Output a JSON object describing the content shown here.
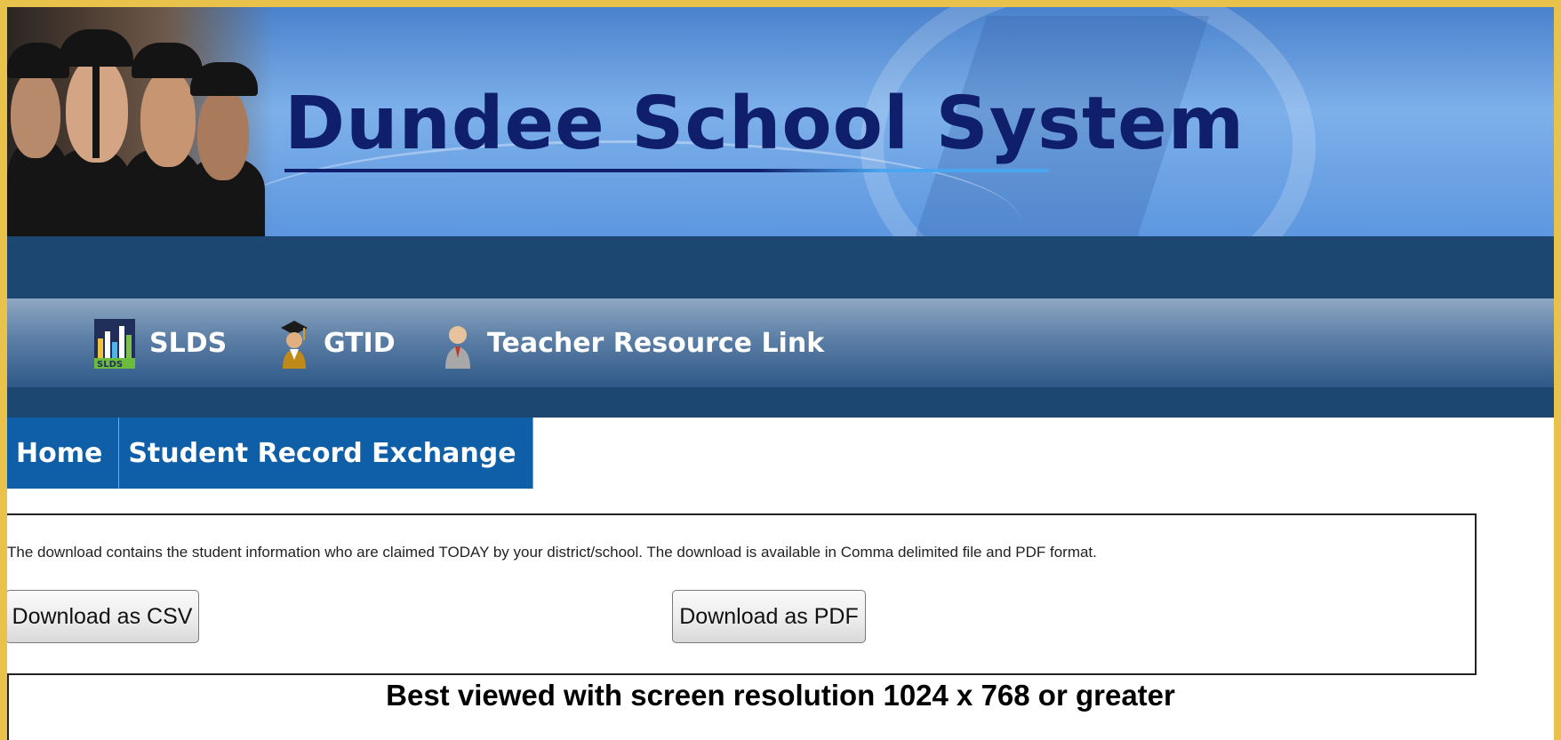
{
  "site": {
    "title": "Dundee School System"
  },
  "nav": {
    "items": [
      {
        "label": "SLDS",
        "icon": "slds-icon"
      },
      {
        "label": "GTID",
        "icon": "graduate-icon"
      },
      {
        "label": "Teacher Resource Link",
        "icon": "teacher-icon"
      }
    ]
  },
  "tabs": [
    {
      "label": "Home"
    },
    {
      "label": "Student Record Exchange"
    }
  ],
  "content": {
    "info_text": "The download contains the student information who are claimed TODAY by your district/school. The download is available in Comma delimited file and PDF format.",
    "csv_button": "Download as CSV",
    "pdf_button": "Download as PDF"
  },
  "footer": {
    "note": "Best viewed with screen resolution 1024 x 768 or greater"
  },
  "colors": {
    "outer_border": "#e8c24a",
    "title": "#0f1f6b",
    "nav_dark": "#1b4770",
    "tab_bg": "#0f5fa8"
  }
}
